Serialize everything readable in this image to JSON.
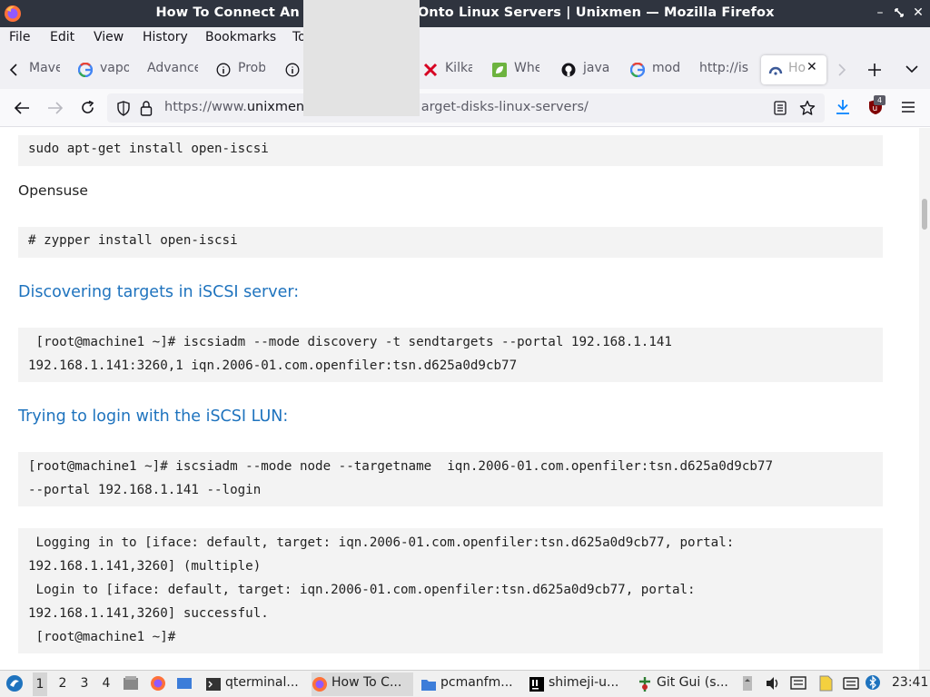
{
  "window": {
    "title": "How To Connect An                Onto Linux Servers | Unixmen — Mozilla Firefox",
    "title_left": "How To Connect An",
    "title_right": "Onto Linux Servers | Unixmen — Mozilla Firefox"
  },
  "menu": [
    "File",
    "Edit",
    "View",
    "History",
    "Bookmarks",
    "To"
  ],
  "tabs": [
    {
      "label": "Mave",
      "icon": "page-icon"
    },
    {
      "label": "vapo",
      "icon": "google-icon"
    },
    {
      "label": "Advance",
      "icon": "none"
    },
    {
      "label": "Probl",
      "icon": "info-icon"
    },
    {
      "label": "",
      "icon": "info-icon"
    },
    {
      "label": "Kilka",
      "icon": "red-x-icon"
    },
    {
      "label": "Whe",
      "icon": "leaf-icon"
    },
    {
      "label": "java",
      "icon": "github-icon"
    },
    {
      "label": "mod",
      "icon": "google-icon"
    },
    {
      "label": "http://is",
      "icon": "none"
    },
    {
      "label": "Ho",
      "icon": "unixmen-icon"
    }
  ],
  "navbar": {
    "url_prefix": "https://www.",
    "url_domain": "unixmen.",
    "url_suffix": "arget-disks-linux-servers/",
    "ublock_count": "4"
  },
  "content": {
    "code1": "sudo apt-get install open-iscsi",
    "opensuse": "Opensuse",
    "code2": "# zypper install open-iscsi",
    "heading1": "Discovering targets in iSCSI server:",
    "code3": [
      " [root@machine1 ~]# iscsiadm --mode discovery -t sendtargets --portal 192.168.1.141",
      "192.168.1.141:3260,1 iqn.2006-01.com.openfiler:tsn.d625a0d9cb77"
    ],
    "heading2": "Trying to login with the iSCSI LUN:",
    "code4": [
      "[root@machine1 ~]# iscsiadm --mode node --targetname  iqn.2006-01.com.openfiler:tsn.d625a0d9cb77",
      "--portal 192.168.1.141 --login"
    ],
    "code5": [
      " Logging in to [iface: default, target: iqn.2006-01.com.openfiler:tsn.d625a0d9cb77, portal:",
      "192.168.1.141,3260] (multiple)",
      " Login to [iface: default, target: iqn.2006-01.com.openfiler:tsn.d625a0d9cb77, portal:",
      "192.168.1.141,3260] successful.",
      " [root@machine1 ~]#"
    ]
  },
  "taskbar": {
    "workspaces": [
      "1",
      "2",
      "3",
      "4"
    ],
    "tasks": [
      {
        "label": "qterminal...",
        "icon": "terminal-icon"
      },
      {
        "label": "How To C...",
        "icon": "firefox-icon"
      },
      {
        "label": "pcmanfm...",
        "icon": "folder-icon"
      },
      {
        "label": "shimeji-u...",
        "icon": "intellij-icon"
      },
      {
        "label": "Git Gui (s...",
        "icon": "git-icon"
      }
    ],
    "clock": "23:41"
  },
  "colors": {
    "titlebar": "#2f343f",
    "heading": "#1e73be",
    "code_bg": "#f3f3f3"
  }
}
